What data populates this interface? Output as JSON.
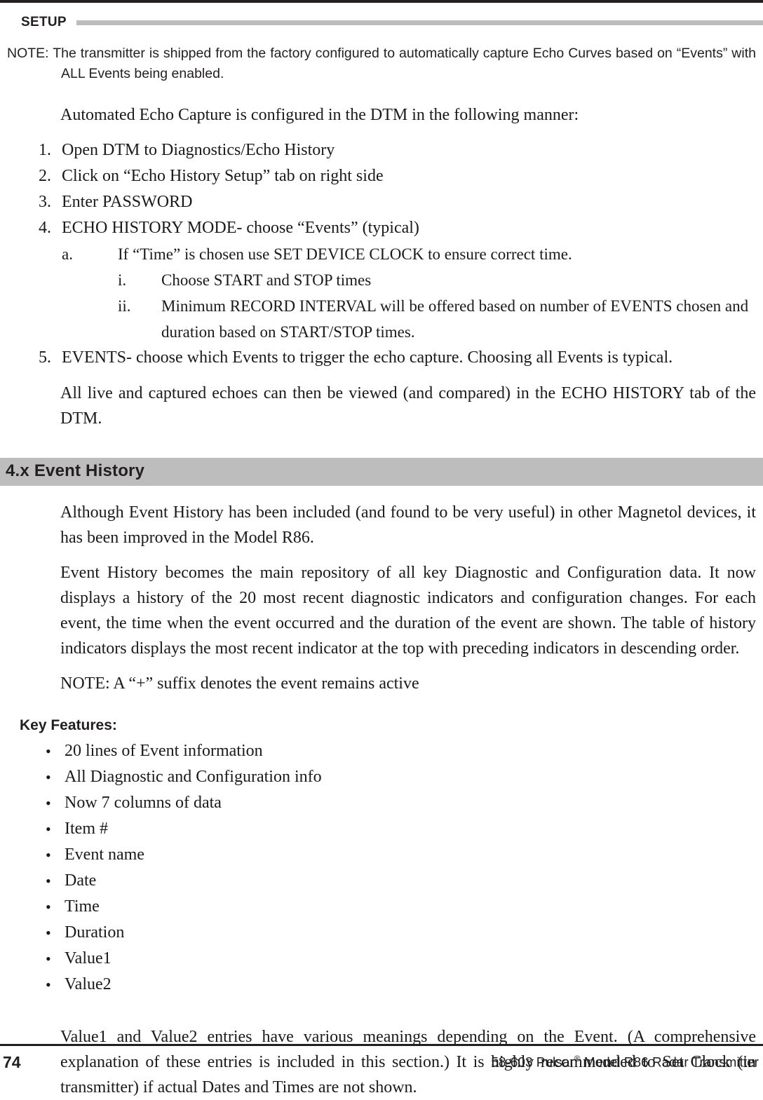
{
  "running_head": {
    "label": "SETUP"
  },
  "note_block": {
    "text": "NOTE: The transmitter is shipped from the factory configured to automatically capture Echo Curves based on “Events” with ALL Events being enabled."
  },
  "intro": {
    "text": "Automated Echo Capture is configured in the DTM in the following manner:"
  },
  "steps": [
    {
      "marker": "1.",
      "text": "Open DTM to Diagnostics/Echo History"
    },
    {
      "marker": "2.",
      "text": "Click on “Echo History Setup” tab on right side"
    },
    {
      "marker": "3.",
      "text": "Enter PASSWORD"
    },
    {
      "marker": "4.",
      "text": "ECHO HISTORY MODE- choose “Events” (typical)"
    }
  ],
  "substeps_a": [
    {
      "marker": "a.",
      "text": "If “Time” is chosen use SET DEVICE CLOCK to ensure correct time."
    }
  ],
  "substeps_roman": [
    {
      "marker": "i.",
      "text": "Choose START and STOP times"
    },
    {
      "marker": "ii.",
      "text": "Minimum RECORD INTERVAL will be offered based on number of EVENTS chosen and duration based on START/STOP times."
    }
  ],
  "steps_after": [
    {
      "marker": "5.",
      "text": "EVENTS- choose which Events to trigger the echo capture.  Choosing all Events is typical."
    }
  ],
  "closing_para": {
    "text": "All live and captured echoes can then be viewed (and compared) in the ECHO HISTORY tab of the DTM."
  },
  "section": {
    "title": "4.x Event History",
    "bar_color": "#bdbdbd"
  },
  "body_paragraphs": [
    {
      "text": "Although Event History has been included (and found to be very useful) in other Magnetol devices, it has been improved in the Model R86."
    },
    {
      "text": "Event History becomes the main repository of all key Diagnostic and Configuration data. It now displays a history of the 20 most recent diagnostic indicators and configuration changes. For each event, the time when the event occurred and the duration of the event are shown. The table of history indicators displays the most recent indicator at the top with preceding indicators in descending order."
    },
    {
      "text": "NOTE: A “+” suffix denotes the event remains active"
    }
  ],
  "key_features": {
    "title": "Key Features:",
    "bullet_glyph": "•",
    "items": [
      "20 lines of Event information",
      "All Diagnostic and Configuration info",
      "Now 7 columns of data",
      "Item #",
      "Event name",
      "Date",
      "Time",
      "Duration",
      "Value1",
      "Value2"
    ]
  },
  "final_para": {
    "text": "Value1 and Value2 entries have various meanings depending on the Event. (A comprehensive explanation of these entries is included in this section.)  It is highly recommended to Set Clock (in transmitter) if actual Dates and Times are not shown."
  },
  "footer": {
    "page_number": "74",
    "text_before_sup": "58-603 Pulsar",
    "sup": "®",
    "text_after_sup": " Model R86 Radar Transmitter"
  }
}
